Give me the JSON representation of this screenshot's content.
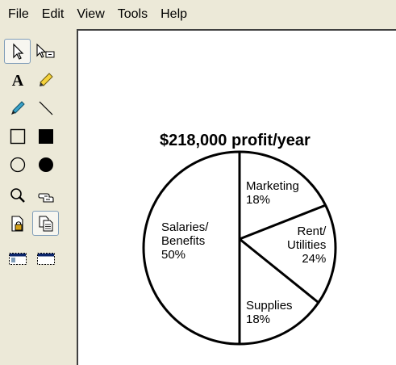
{
  "menu": {
    "items": [
      {
        "label": "File"
      },
      {
        "label": "Edit"
      },
      {
        "label": "View"
      },
      {
        "label": "Tools"
      },
      {
        "label": "Help"
      }
    ]
  },
  "toolbox": {
    "tools": [
      {
        "name": "select-arrow-icon",
        "active": true
      },
      {
        "name": "select-region-icon",
        "active": false
      },
      {
        "name": "text-tool-icon",
        "active": false,
        "glyph": "A"
      },
      {
        "name": "highlighter-icon",
        "active": false
      },
      {
        "name": "pencil-icon",
        "active": false
      },
      {
        "name": "line-tool-icon",
        "active": false
      },
      {
        "name": "rectangle-outline-icon",
        "active": false
      },
      {
        "name": "rectangle-filled-icon",
        "active": false
      },
      {
        "name": "ellipse-outline-icon",
        "active": false
      },
      {
        "name": "ellipse-filled-icon",
        "active": false
      },
      {
        "name": "magnifier-icon",
        "active": false
      },
      {
        "name": "hand-pointer-icon",
        "active": false
      },
      {
        "name": "lock-page-icon",
        "active": false
      },
      {
        "name": "copy-pages-icon",
        "active": true
      },
      {
        "name": "window-dotted-icon",
        "active": false
      },
      {
        "name": "window-dotted-alt-icon",
        "active": false
      }
    ]
  },
  "canvas": {
    "title": "$218,000 profit/year",
    "slices": [
      {
        "label": "Marketing\n18%",
        "percent": 18
      },
      {
        "label": "Rent/\nUtilities\n24%",
        "percent": 24
      },
      {
        "label": "Supplies\n18%",
        "percent": 18
      },
      {
        "label": "Salaries/\nBenefits\n50%",
        "percent": 50
      }
    ]
  }
}
